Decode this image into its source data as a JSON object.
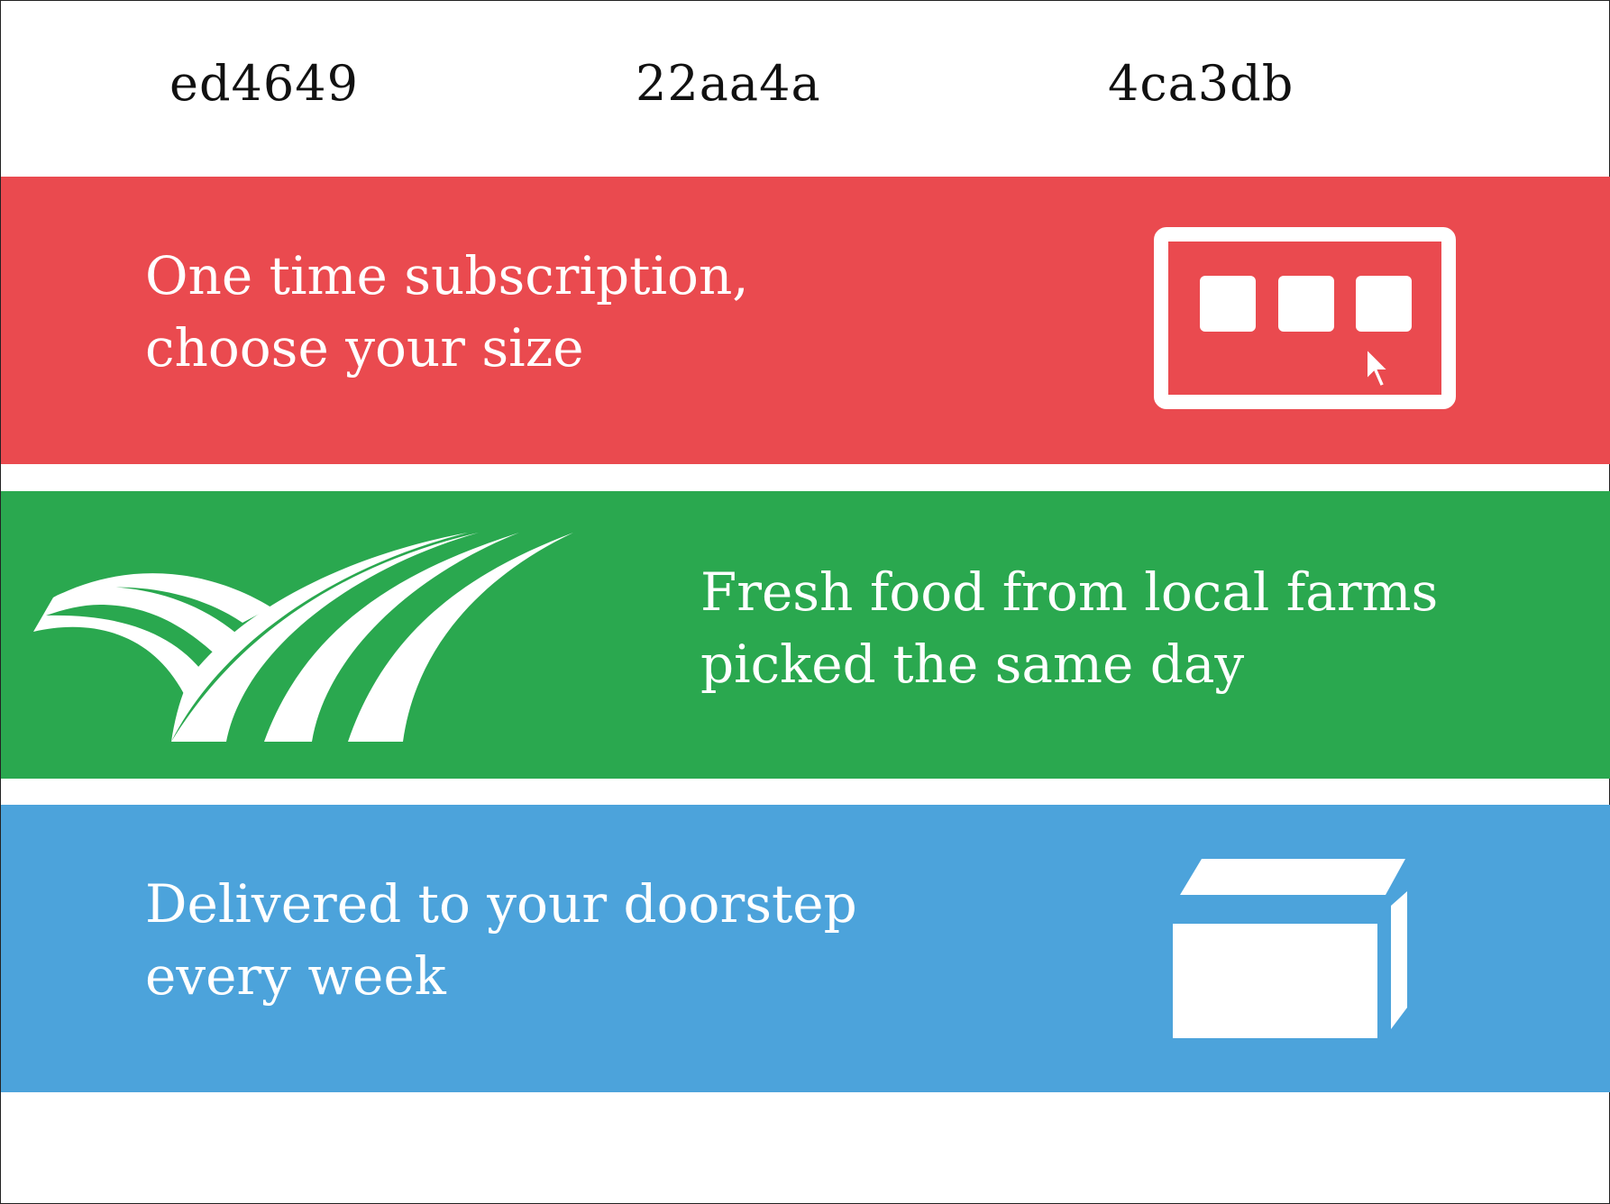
{
  "header": {
    "codes": [
      "ed4649",
      "22aa4a",
      "4ca3db"
    ]
  },
  "colors": {
    "red": "#ea4a4f",
    "green": "#2aa84f",
    "blue": "#4ca3db"
  },
  "bands": {
    "subscription": {
      "line1": "One time subscription,",
      "line2": "choose your size",
      "icon": "size-selector-icon"
    },
    "fresh": {
      "line1": "Fresh food from local farms",
      "line2": "picked the same day",
      "icon": "farm-fields-icon"
    },
    "delivery": {
      "line1": "Delivered to your doorstep",
      "line2": "every week",
      "icon": "box-icon"
    }
  }
}
